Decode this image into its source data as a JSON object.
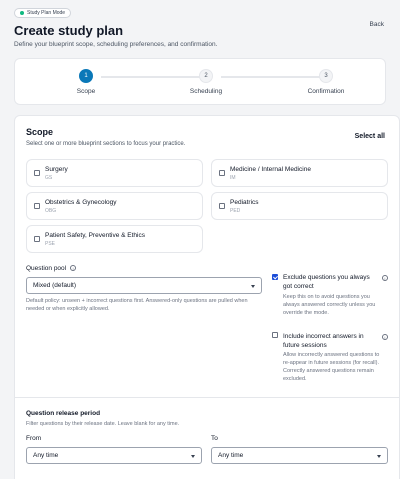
{
  "header": {
    "mode_badge": "Study Plan Mode",
    "title": "Create study plan",
    "subtitle": "Define your blueprint scope, scheduling preferences, and confirmation.",
    "back_label": "Back"
  },
  "stepper": {
    "steps": [
      {
        "number": "1",
        "label": "Scope",
        "active": true
      },
      {
        "number": "2",
        "label": "Scheduling",
        "active": false
      },
      {
        "number": "3",
        "label": "Confirmation",
        "active": false
      }
    ]
  },
  "scope": {
    "title": "Scope",
    "subtitle": "Select one or more blueprint sections to focus your practice.",
    "select_all": "Select all",
    "sections": [
      {
        "name": "Surgery",
        "code": "GS"
      },
      {
        "name": "Medicine / Internal Medicine",
        "code": "IM"
      },
      {
        "name": "Obstetrics & Gynecology",
        "code": "OBG"
      },
      {
        "name": "Pediatrics",
        "code": "PED"
      },
      {
        "name": "Patient Safety, Preventive & Ethics",
        "code": "PSE"
      }
    ]
  },
  "question_pool": {
    "label": "Question pool",
    "selected": "Mixed (default)",
    "help": "Default policy: unseen + incorrect questions first. Answered-only questions are pulled when needed or when explicitly allowed."
  },
  "options": [
    {
      "title": "Exclude questions you always got correct",
      "checked": true,
      "help": "Keep this on to avoid questions you always answered correctly unless you override the mode."
    },
    {
      "title": "Include incorrect answers in future sessions",
      "checked": false,
      "help": "Allow incorrectly answered questions to re-appear in future sessions (for recall). Correctly answered questions remain excluded."
    }
  ],
  "release_period": {
    "title": "Question release period",
    "help": "Filter questions by their release date. Leave blank for any time.",
    "from_label": "From",
    "to_label": "To",
    "from_value": "Any time",
    "to_value": "Any time"
  },
  "colors": {
    "accent": "#0b78b8",
    "checkbox_checked": "#1d4ed8",
    "badge_dot": "#10b981"
  }
}
